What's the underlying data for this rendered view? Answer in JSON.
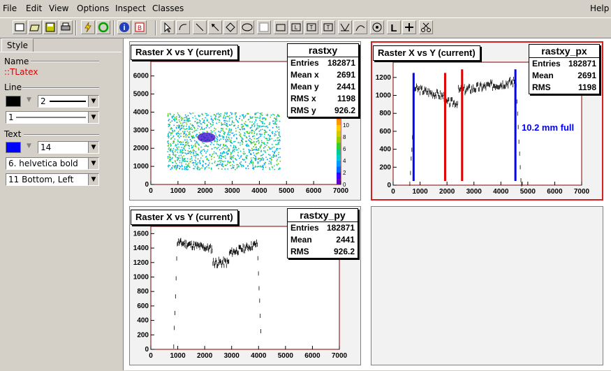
{
  "menu": {
    "file": "File",
    "edit": "Edit",
    "view": "View",
    "options": "Options",
    "inspect": "Inspect",
    "classes": "Classes",
    "help": "Help"
  },
  "sidebar": {
    "tab_style": "Style",
    "name_label": "Name",
    "name_value": "::TLatex",
    "line_label": "Line",
    "line_color": "#000000",
    "line_width": "2",
    "line_style": "1",
    "text_label": "Text",
    "text_color": "#0000ff",
    "text_size": "14",
    "text_font": "6. helvetica bold",
    "text_align": "11 Bottom, Left"
  },
  "pads": {
    "p1": {
      "title": "Raster X vs Y (current)",
      "stats_name": "rastxy",
      "stats": [
        {
          "k": "Entries",
          "v": "182871"
        },
        {
          "k": "Mean x",
          "v": "2691"
        },
        {
          "k": "Mean y",
          "v": "2441"
        },
        {
          "k": "RMS x",
          "v": "1198"
        },
        {
          "k": "RMS y",
          "v": "926.2"
        }
      ],
      "x_ticks": [
        "0",
        "1000",
        "2000",
        "3000",
        "4000",
        "5000",
        "6000",
        "7000"
      ],
      "y_ticks": [
        "0",
        "1000",
        "2000",
        "3000",
        "4000",
        "5000",
        "6000"
      ],
      "z_ticks": [
        "0",
        "2",
        "4",
        "6",
        "8",
        "10",
        "12"
      ]
    },
    "p2": {
      "title": "Raster X vs Y (current)",
      "stats_name": "rastxy_px",
      "stats": [
        {
          "k": "Entries",
          "v": "182871"
        },
        {
          "k": "Mean",
          "v": "2691"
        },
        {
          "k": "RMS",
          "v": "1198"
        }
      ],
      "x_ticks": [
        "0",
        "1000",
        "2000",
        "3000",
        "4000",
        "5000",
        "6000",
        "7000"
      ],
      "y_ticks": [
        "0",
        "200",
        "400",
        "600",
        "800",
        "1000",
        "1200"
      ],
      "annotation": "10.2 mm full"
    },
    "p3": {
      "title": "Raster X vs Y (current)",
      "stats_name": "rastxy_py",
      "stats": [
        {
          "k": "Entries",
          "v": "182871"
        },
        {
          "k": "Mean",
          "v": "2441"
        },
        {
          "k": "RMS",
          "v": "926.2"
        }
      ],
      "x_ticks": [
        "0",
        "1000",
        "2000",
        "3000",
        "4000",
        "5000",
        "6000",
        "7000"
      ],
      "y_ticks": [
        "0",
        "200",
        "400",
        "600",
        "800",
        "1000",
        "1200",
        "1400",
        "1600"
      ]
    }
  },
  "colors": {
    "blue_line": "#0000ff",
    "red_line": "#e00000",
    "sel_border": "#d42020",
    "axis_frame": "#800000"
  }
}
